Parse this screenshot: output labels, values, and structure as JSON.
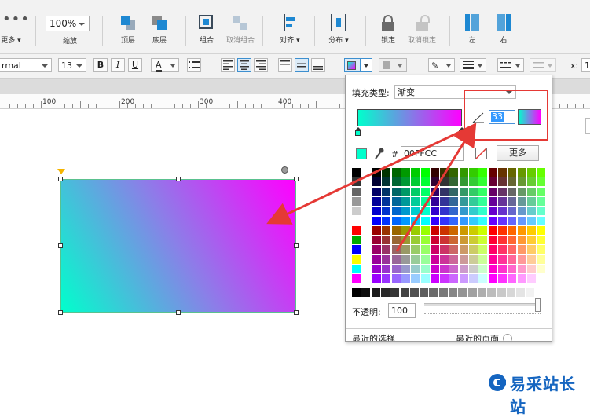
{
  "toolbar1": {
    "more_label": "更多",
    "zoom_value": "100%",
    "zoom_label": "缩放",
    "top_label": "顶层",
    "bottom_label": "底层",
    "group_label": "组合",
    "ungroup_label": "取消组合",
    "align_label": "对齐",
    "distribute_label": "分布",
    "lock_label": "锁定",
    "unlock_label": "取消锁定",
    "left_label": "左",
    "right_label": "右"
  },
  "toolbar2": {
    "style_value": "rmal",
    "font_size": "13",
    "bold": "B",
    "italic": "I",
    "underline": "U",
    "font_color": "A",
    "x_label": "x:",
    "x_value": "1"
  },
  "ruler": {
    "labels": [
      "100",
      "200",
      "300",
      "400"
    ]
  },
  "fill": {
    "type_label": "填充类型:",
    "type_value": "渐变",
    "angle_value": "33",
    "hash": "#",
    "hex_value": "00FFCC",
    "more_button": "更多",
    "opacity_label": "不透明:",
    "opacity_value": "100",
    "recent_selection": "最近的选择",
    "recent_page": "最近的页面"
  },
  "colors": {
    "gradient_start": "#00ffcc",
    "gradient_end": "#ff00ff",
    "accent_red": "#e53935"
  },
  "watermark": {
    "text": "易采站长站"
  }
}
